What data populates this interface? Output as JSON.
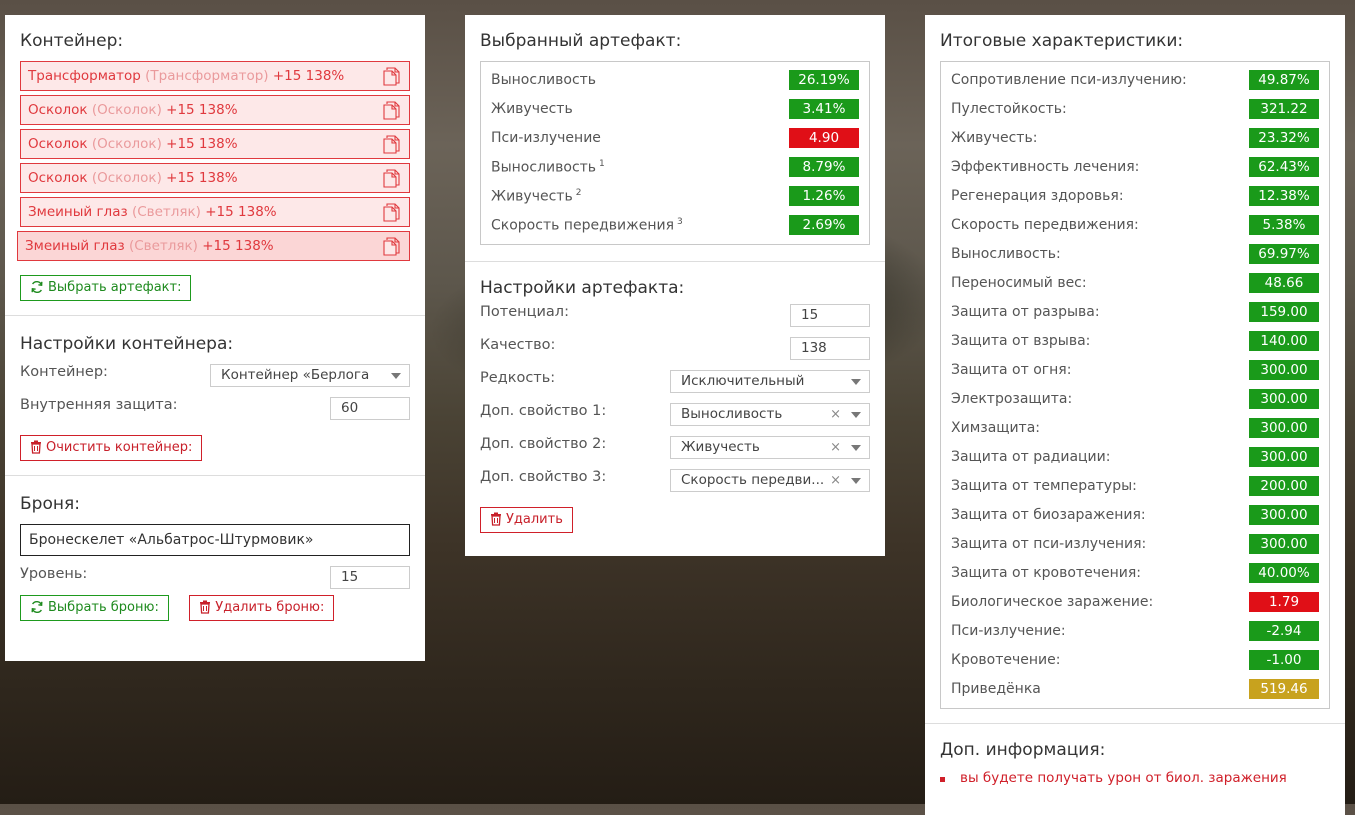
{
  "colors": {
    "positive": "#1a9a1a",
    "negative": "#e00f17",
    "warning": "#c8a21e",
    "danger": "#e0393e"
  },
  "container_panel": {
    "title": "Контейнер:",
    "artifacts": [
      {
        "name": "Трансформатор",
        "sub": "(Трансформатор)",
        "suffix": "+15 138%"
      },
      {
        "name": "Осколок",
        "sub": "(Осколок)",
        "suffix": "+15 138%"
      },
      {
        "name": "Осколок",
        "sub": "(Осколок)",
        "suffix": "+15 138%"
      },
      {
        "name": "Осколок",
        "sub": "(Осколок)",
        "suffix": "+15 138%"
      },
      {
        "name": "Змеиный глаз",
        "sub": "(Светляк)",
        "suffix": "+15 138%"
      },
      {
        "name": "Змеиный глаз",
        "sub": "(Светляк)",
        "suffix": "+15 138%"
      }
    ],
    "select_artifact_button": "Выбрать артефакт:",
    "settings": {
      "title": "Настройки контейнера:",
      "container_label": "Контейнер:",
      "container_value": "Контейнер «Берлога...",
      "inner_protection_label": "Внутренняя защита:",
      "inner_protection_value": "60",
      "clear_button": "Очистить контейнер:"
    },
    "armor": {
      "title": "Броня:",
      "value": "Бронескелет «Альбатрос-Штурмовик»",
      "level_label": "Уровень:",
      "level_value": "15",
      "select_button": "Выбрать броню:",
      "delete_button": "Удалить броню:"
    }
  },
  "artifact_panel": {
    "title": "Выбранный артефакт:",
    "stats": [
      {
        "name": "Выносливость",
        "sup": "",
        "value": "26.19%",
        "status": "positive"
      },
      {
        "name": "Живучесть",
        "sup": "",
        "value": "3.41%",
        "status": "positive"
      },
      {
        "name": "Пси-излучение",
        "sup": "",
        "value": "4.90",
        "status": "negative"
      },
      {
        "name": "Выносливость",
        "sup": "1",
        "value": "8.79%",
        "status": "positive"
      },
      {
        "name": "Живучесть",
        "sup": "2",
        "value": "1.26%",
        "status": "positive"
      },
      {
        "name": "Скорость передвижения",
        "sup": "3",
        "value": "2.69%",
        "status": "positive"
      }
    ],
    "settings": {
      "title": "Настройки артефакта:",
      "potential_label": "Потенциал:",
      "potential_value": "15",
      "quality_label": "Качество:",
      "quality_value": "138",
      "rarity_label": "Редкость:",
      "rarity_value": "Исключительный",
      "prop1_label": "Доп. свойство 1:",
      "prop1_value": "Выносливость",
      "prop2_label": "Доп. свойство 2:",
      "prop2_value": "Живучесть",
      "prop3_label": "Доп. свойство 3:",
      "prop3_value": "Скорость передви...",
      "clear_glyph": "×",
      "delete_button": "Удалить"
    }
  },
  "totals_panel": {
    "title": "Итоговые характеристики:",
    "stats": [
      {
        "name": "Сопротивление пси-излучению:",
        "value": "49.87%",
        "status": "positive"
      },
      {
        "name": "Пулестойкость:",
        "value": "321.22",
        "status": "positive"
      },
      {
        "name": "Живучесть:",
        "value": "23.32%",
        "status": "positive"
      },
      {
        "name": "Эффективность лечения:",
        "value": "62.43%",
        "status": "positive"
      },
      {
        "name": "Регенерация здоровья:",
        "value": "12.38%",
        "status": "positive"
      },
      {
        "name": "Скорость передвижения:",
        "value": "5.38%",
        "status": "positive"
      },
      {
        "name": "Выносливость:",
        "value": "69.97%",
        "status": "positive"
      },
      {
        "name": "Переносимый вес:",
        "value": "48.66",
        "status": "positive"
      },
      {
        "name": "Защита от разрыва:",
        "value": "159.00",
        "status": "positive"
      },
      {
        "name": "Защита от взрыва:",
        "value": "140.00",
        "status": "positive"
      },
      {
        "name": "Защита от огня:",
        "value": "300.00",
        "status": "positive"
      },
      {
        "name": "Электрозащита:",
        "value": "300.00",
        "status": "positive"
      },
      {
        "name": "Химзащита:",
        "value": "300.00",
        "status": "positive"
      },
      {
        "name": "Защита от радиации:",
        "value": "300.00",
        "status": "positive"
      },
      {
        "name": "Защита от температуры:",
        "value": "200.00",
        "status": "positive"
      },
      {
        "name": "Защита от биозаражения:",
        "value": "300.00",
        "status": "positive"
      },
      {
        "name": "Защита от пси-излучения:",
        "value": "300.00",
        "status": "positive"
      },
      {
        "name": "Защита от кровотечения:",
        "value": "40.00%",
        "status": "positive"
      },
      {
        "name": "Биологическое заражение:",
        "value": "1.79",
        "status": "negative"
      },
      {
        "name": "Пси-излучение:",
        "value": "-2.94",
        "status": "positive"
      },
      {
        "name": "Кровотечение:",
        "value": "-1.00",
        "status": "positive"
      },
      {
        "name": "Приведёнка",
        "value": "519.46",
        "status": "warning"
      }
    ],
    "info": {
      "title": "Доп. информация:",
      "items": [
        "вы будете получать урон от биол. заражения"
      ]
    }
  }
}
